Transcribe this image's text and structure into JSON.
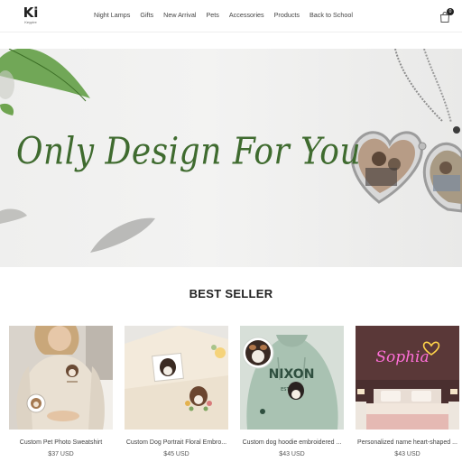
{
  "brand": {
    "logo_mark": "Ki",
    "logo_sub": "Keypire"
  },
  "nav": {
    "items": [
      "Night Lamps",
      "Gifts",
      "New Arrival",
      "Pets",
      "Accessories",
      "Products",
      "Back to School"
    ]
  },
  "cart": {
    "count": "0",
    "icon": "shopping-bag-icon"
  },
  "hero": {
    "headline": "Only Design For You"
  },
  "section": {
    "title": "BEST SELLER"
  },
  "products": [
    {
      "name": "Custom Pet Photo Sweatshirt",
      "price": "$37 USD"
    },
    {
      "name": "Custom Dog Portrait Floral Embro...",
      "price": "$45 USD"
    },
    {
      "name": "Custom dog hoodie embroidered ...",
      "price": "$43 USD"
    },
    {
      "name": "Personalized name heart-shaped ...",
      "price": "$43 USD"
    }
  ],
  "product_images": {
    "embroidery_name": "NIXON",
    "embroidery_year": "EST 2023",
    "neon_text": "Sophia"
  },
  "colors": {
    "accent_green": "#3f6b2f",
    "neon_pink": "#ff6fd8"
  }
}
